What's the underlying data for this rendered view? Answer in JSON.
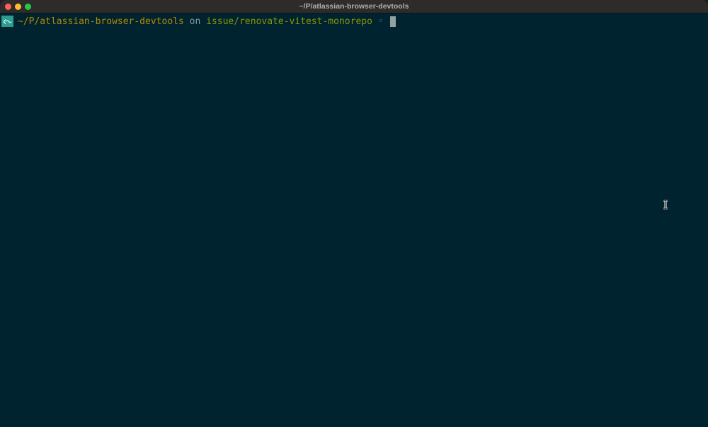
{
  "window": {
    "title": "~/P/atlassian-browser-devtools"
  },
  "prompt": {
    "icon": "terminal-prompt-icon",
    "path": "~/P/atlassian-browser-devtools",
    "on": " on ",
    "branch": "issue/renovate-vitest-monorepo",
    "status": " ◦ "
  },
  "colors": {
    "background": "#002330",
    "path": "#b58900",
    "branch": "#859900",
    "icon_bg": "#2a9d8f"
  },
  "pointer": {
    "icon": "ibeam-cursor-icon"
  }
}
